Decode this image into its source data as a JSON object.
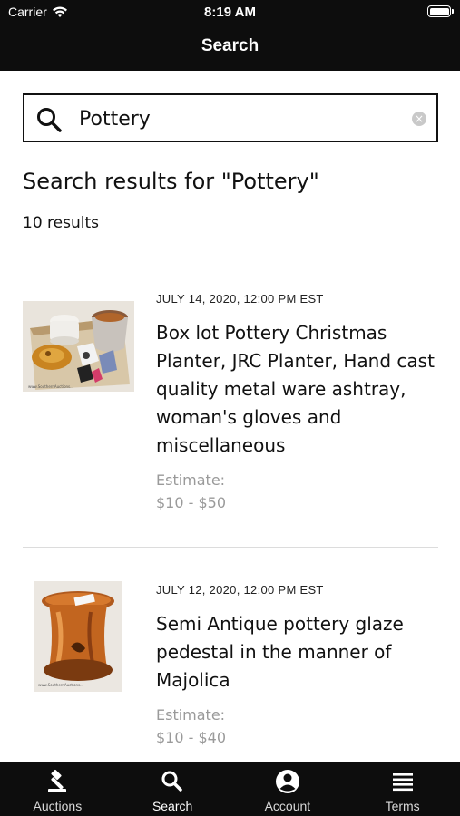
{
  "status_bar": {
    "carrier": "Carrier",
    "time": "8:19 AM"
  },
  "nav": {
    "title": "Search"
  },
  "search": {
    "value": "Pottery",
    "clear_glyph": "×"
  },
  "results": {
    "heading": "Search results for \"Pottery\"",
    "count_text": "10 results",
    "items": [
      {
        "date": "JULY 14, 2020, 12:00 PM EST",
        "title": "Box lot Pottery Christmas Planter, JRC Planter, Hand cast quality metal ware ashtray, woman's gloves and miscellaneous",
        "estimate_label": "Estimate:",
        "estimate_value": "$10 - $50"
      },
      {
        "date": "JULY 12, 2020, 12:00 PM EST",
        "title": "Semi Antique pottery glaze pedestal in the manner of Majolica",
        "estimate_label": "Estimate:",
        "estimate_value": "$10 - $40"
      }
    ]
  },
  "tabbar": {
    "tabs": [
      {
        "label": "Auctions",
        "icon": "gavel-icon"
      },
      {
        "label": "Search",
        "icon": "search-icon"
      },
      {
        "label": "Account",
        "icon": "account-icon"
      },
      {
        "label": "Terms",
        "icon": "menu-lines-icon"
      }
    ],
    "active": "Search"
  },
  "colors": {
    "bar_bg": "#0d0d0d",
    "muted_text": "#9a9a9a",
    "divider": "#dcdcdc"
  }
}
